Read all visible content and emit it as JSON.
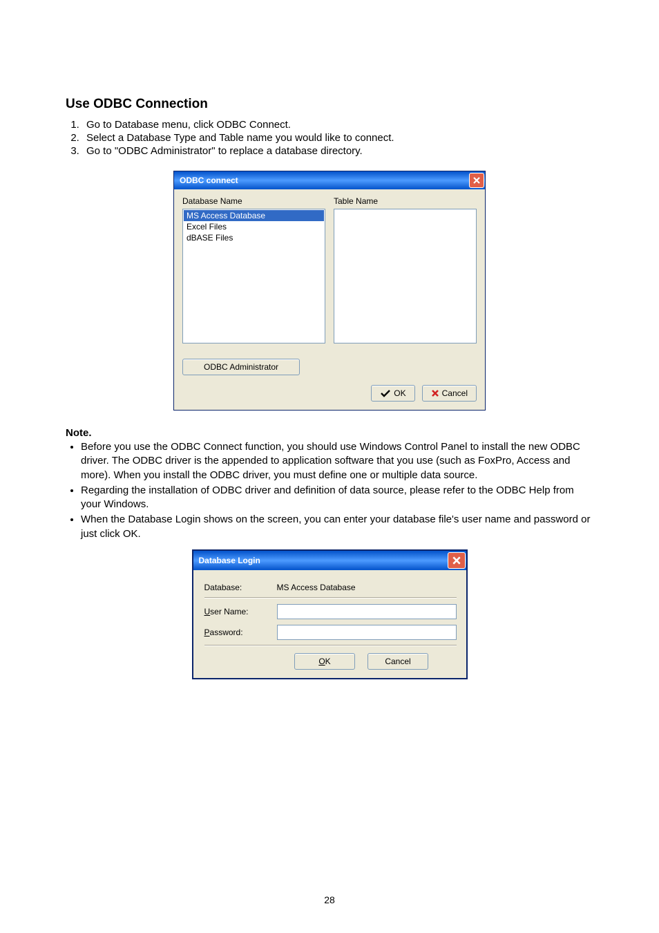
{
  "heading": "Use ODBC Connection",
  "steps": [
    "Go to Database menu, click ODBC Connect.",
    "Select a Database Type and Table name you would like to connect.",
    "Go to \"ODBC Administrator\" to replace a database directory."
  ],
  "odbc_dialog": {
    "title": "ODBC connect",
    "db_label": "Database Name",
    "table_label": "Table Name",
    "db_items": [
      "MS Access Database",
      "Excel Files",
      "dBASE Files"
    ],
    "selected_index": 0,
    "admin_btn": "ODBC Administrator",
    "ok_btn": "OK",
    "cancel_btn": "Cancel"
  },
  "note_heading": "Note.",
  "notes": [
    "Before you use the ODBC Connect function, you should use Windows Control Panel to install the new ODBC driver. The ODBC driver is the appended to application software that you use (such as FoxPro, Access and more). When you install the ODBC driver, you must define one or multiple data source.",
    "Regarding the installation of ODBC driver and definition of data source, please refer to the ODBC Help from your Windows.",
    "When the Database Login shows on the screen, you can enter your database file's user name and password or just click OK."
  ],
  "login_dialog": {
    "title": "Database Login",
    "database_label": "Database:",
    "database_value": "MS Access Database",
    "user_label_prefix": "U",
    "user_label_rest": "ser Name:",
    "pass_label_prefix": "P",
    "pass_label_rest": "assword:",
    "ok_prefix": "O",
    "ok_rest": "K",
    "cancel": "Cancel",
    "user_value": "",
    "pass_value": ""
  },
  "page_number": "28"
}
